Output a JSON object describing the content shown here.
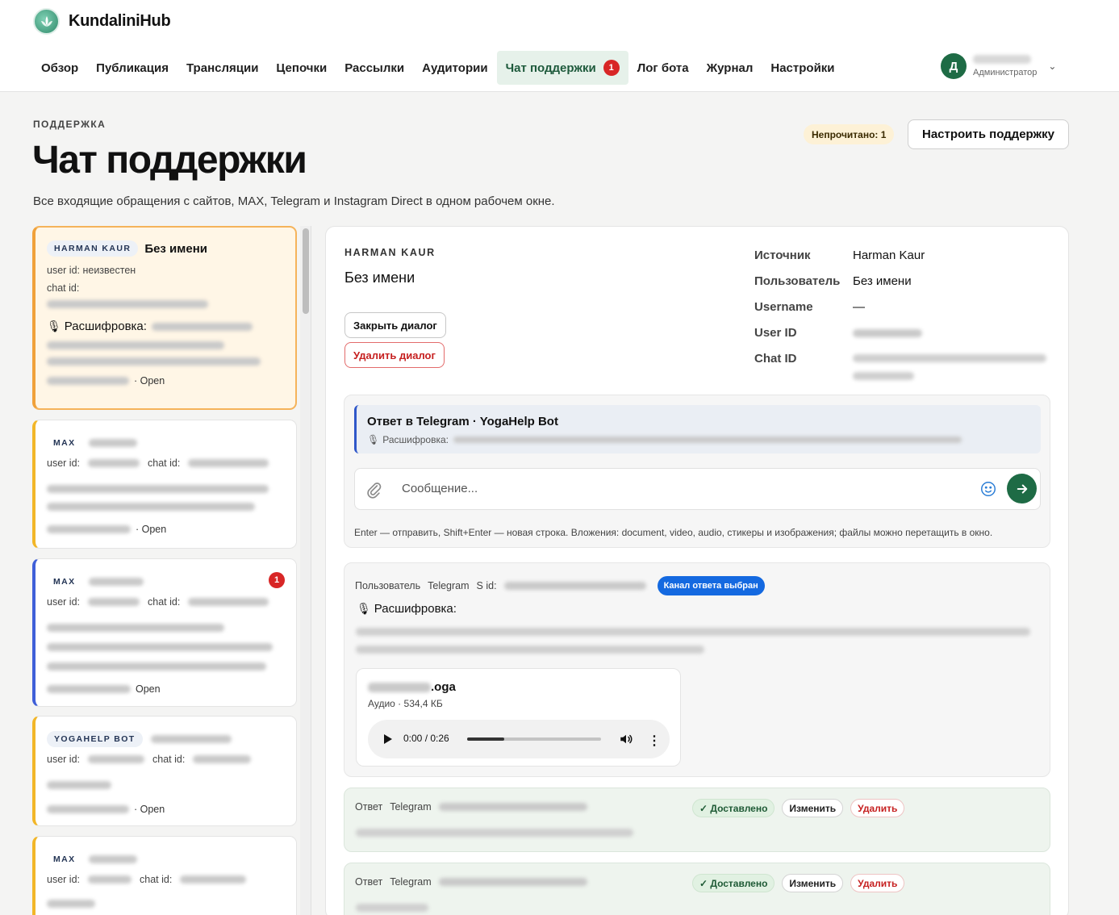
{
  "brand": {
    "name": "KundaliniHub"
  },
  "nav": {
    "items": [
      {
        "label": "Обзор"
      },
      {
        "label": "Публикация"
      },
      {
        "label": "Трансляции"
      },
      {
        "label": "Цепочки"
      },
      {
        "label": "Рассылки"
      },
      {
        "label": "Аудитории"
      },
      {
        "label": "Чат поддержки",
        "badge": "1",
        "active": true
      },
      {
        "label": "Лог бота"
      },
      {
        "label": "Журнал"
      },
      {
        "label": "Настройки"
      }
    ]
  },
  "user": {
    "initial": "Д",
    "role": "Администратор"
  },
  "page": {
    "eyebrow": "ПОДДЕРЖКА",
    "title": "Чат поддержки",
    "description": "Все входящие обращения с сайтов, MAX, Telegram и Instagram Direct в одном рабочем окне.",
    "unread": "Непрочитано: 1",
    "config_button": "Настроить поддержку"
  },
  "conversations": [
    {
      "source": "HARMAN KAUR",
      "name": "Без имени",
      "user_id": "user id: неизвестен",
      "chat_id": "chat id:",
      "transcript": "Расшифровка:",
      "status": "· Open"
    },
    {
      "source": "MAX",
      "user_id": "user id:",
      "chat_id": "chat id:",
      "status": "· Open"
    },
    {
      "source": "MAX",
      "user_id": "user id:",
      "chat_id": "chat id:",
      "status": "Open",
      "badge": "1"
    },
    {
      "source": "YOGAHELP BOT",
      "user_id": "user id:",
      "chat_id": "chat id:",
      "status": "· Open"
    },
    {
      "source": "MAX",
      "user_id": "user id:",
      "chat_id": "chat id:"
    }
  ],
  "detail": {
    "source": "HARMAN KAUR",
    "name": "Без имени",
    "close_button": "Закрыть диалог",
    "delete_button": "Удалить диалог",
    "meta": [
      {
        "label": "Источник",
        "value": "Harman Kaur"
      },
      {
        "label": "Пользователь",
        "value": "Без имени"
      },
      {
        "label": "Username",
        "value": "—"
      },
      {
        "label": "User ID",
        "value": ""
      },
      {
        "label": "Chat ID",
        "value": ""
      }
    ]
  },
  "composer": {
    "reply_title": "Ответ в Telegram · YogaHelp Bot",
    "reply_sub": "Расшифровка:",
    "placeholder": "Сообщение...",
    "hint": "Enter — отправить, Shift+Enter — новая строка. Вложения: document, video, audio, стикеры и изображения; файлы можно перетащить в окно."
  },
  "message": {
    "role": "Пользователь",
    "channel": "Telegram",
    "id_label": "S id:",
    "channel_pill": "Канал ответа выбран",
    "transcript": "Расшифровка:",
    "file_ext": ".oga",
    "file_meta": "Аудио · 534,4 КБ",
    "time": "0:00 / 0:26",
    "progress": 0.28
  },
  "answers": [
    {
      "role": "Ответ",
      "channel": "Telegram",
      "delivered": "✓ Доставлено",
      "edit": "Изменить",
      "delete": "Удалить"
    },
    {
      "role": "Ответ",
      "channel": "Telegram",
      "delivered": "✓ Доставлено",
      "edit": "Изменить",
      "delete": "Удалить"
    }
  ],
  "colors": {
    "accent": "#1e6b45",
    "badge": "#d82626",
    "channel_pill": "#1469e0",
    "selected_border": "#f5b35a"
  }
}
